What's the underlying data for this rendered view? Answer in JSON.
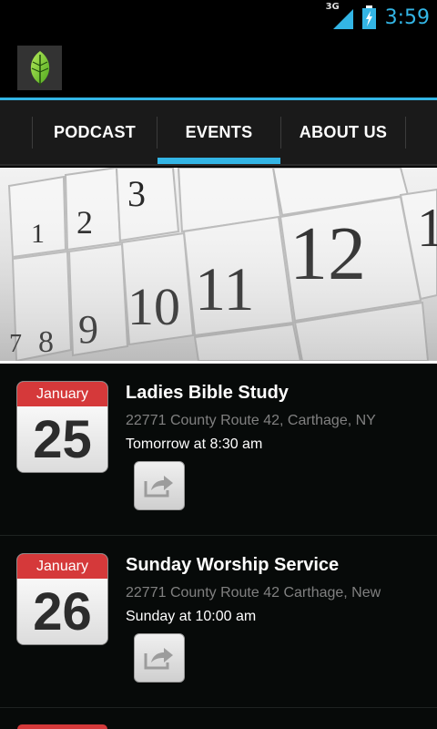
{
  "status_bar": {
    "network": "3G",
    "time": "3:59"
  },
  "colors": {
    "accent": "#33b5e5",
    "calendar_month": "#d5393a",
    "background": "#000000"
  },
  "tabs": [
    {
      "label": "PODCAST",
      "selected": false
    },
    {
      "label": "EVENTS",
      "selected": true
    },
    {
      "label": "ABOUT US",
      "selected": false
    }
  ],
  "banner": {
    "calendar_numbers": [
      "1",
      "2",
      "3",
      "7",
      "8",
      "9",
      "10",
      "11",
      "12",
      "1"
    ]
  },
  "events": [
    {
      "month": "January",
      "day": "25",
      "title": "Ladies Bible Study",
      "location": "22771 County Route 42, Carthage, NY",
      "time": "Tomorrow at 8:30 am",
      "share_icon": "share-icon"
    },
    {
      "month": "January",
      "day": "26",
      "title": "Sunday Worship Service",
      "location": "22771 County Route 42 Carthage, New",
      "time": "Sunday at 10:00 am",
      "share_icon": "share-icon"
    }
  ]
}
